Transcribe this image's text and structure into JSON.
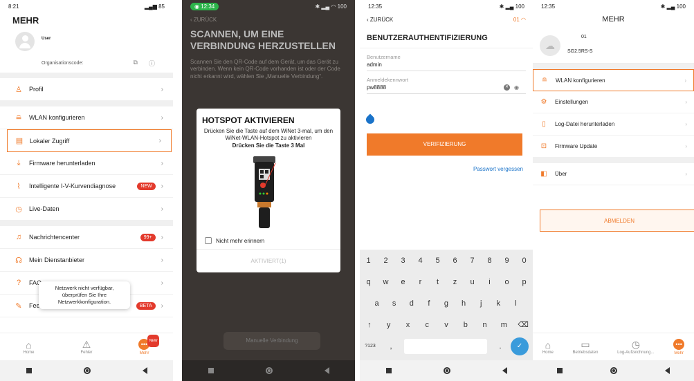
{
  "s1": {
    "time": "8:21",
    "status_right": "4G",
    "battery": "85",
    "title": "MEHR",
    "username": "User",
    "org_label": "Organisationscode:",
    "items": [
      {
        "label": "Profil"
      },
      {
        "label": "WLAN konfigurieren"
      },
      {
        "label": "Lokaler Zugriff"
      },
      {
        "label": "Firmware herunterladen"
      },
      {
        "label": "Intelligente I-V-Kurvendiagnose",
        "badge": "NEW"
      },
      {
        "label": "Live-Daten"
      },
      {
        "label": "Nachrichtencenter",
        "badge": "99+"
      },
      {
        "label": "Mein Dienstanbieter"
      },
      {
        "label": "FAQ"
      },
      {
        "label": "Feedback",
        "badge": "BETA"
      }
    ],
    "toast": "Netzwerk nicht verfügbar, überprüfen Sie Ihre Netzwerkkonfiguration.",
    "tabs": [
      "Home",
      "Fehler",
      "Mehr"
    ],
    "tab_new": "NEW"
  },
  "s2": {
    "time": "12:34",
    "battery": "100",
    "back": "ZURÜCK",
    "title": "SCANNEN, UM EINE VERBINDUNG HERZUSTELLEN",
    "text": "Scannen Sie den QR-Code auf dem Gerät, um das Gerät zu verbinden. Wenn kein QR-Code vorhanden ist oder der Code nicht erkannt wird, wählen Sie „Manuelle Verbindung“.",
    "modal_title": "HOTSPOT AKTIVIEREN",
    "modal_text": "Drücken Sie die Taste auf dem WiNet 3-mal, um den WiNet-WLAN-Hotspot zu aktivieren",
    "modal_strong": "Drücken Sie die Taste 3 Mal",
    "checkbox_label": "Nicht mehr erinnern",
    "action": "AKTIVIERT(1)",
    "bottom_button": "Manuelle Verbindung"
  },
  "s3": {
    "time": "12:35",
    "battery": "100",
    "back": "ZURÜCK",
    "step": "01",
    "title": "BENUTZERAUTHENTIFIZIERUNG",
    "user_label": "Benutzername",
    "user_value": "admin",
    "pw_label": "Anmeldekennwort",
    "pw_value": "pw8888",
    "verify": "VERIFIZIERUNG",
    "forgot": "Passwort vergessen",
    "keys_num": [
      "1",
      "2",
      "3",
      "4",
      "5",
      "6",
      "7",
      "8",
      "9",
      "0"
    ],
    "keys_row1": [
      "q",
      "w",
      "e",
      "r",
      "t",
      "z",
      "u",
      "i",
      "o",
      "p"
    ],
    "keys_row2": [
      "a",
      "s",
      "d",
      "f",
      "g",
      "h",
      "j",
      "k",
      "l"
    ],
    "keys_row3": [
      "y",
      "x",
      "c",
      "v",
      "b",
      "n",
      "m"
    ],
    "key_sym": "?123",
    "key_comma": ",",
    "key_dot": "."
  },
  "s4": {
    "time": "12:35",
    "battery": "100",
    "title": "MEHR",
    "device_num": "01",
    "device_name": "SG2.5RS-S",
    "items": [
      {
        "label": "WLAN konfigurieren"
      },
      {
        "label": "Einstellungen"
      },
      {
        "label": "Log-Datei herunterladen"
      },
      {
        "label": "Firmware Update"
      },
      {
        "label": "Über"
      }
    ],
    "logout": "ABMELDEN",
    "tabs": [
      "Home",
      "Betriebsdaten",
      "Log-Aufzeichnung...",
      "Mehr"
    ]
  },
  "colors": {
    "accent": "#f07a2a",
    "badge": "#e33a2c",
    "link": "#1a73c9"
  }
}
